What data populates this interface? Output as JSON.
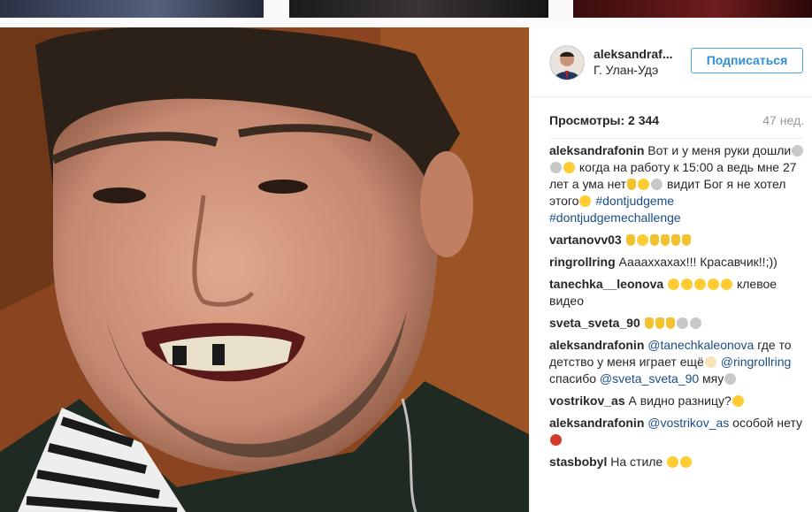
{
  "post": {
    "username": "aleksandraf...",
    "location": "Г. Улан-Удэ",
    "follow_label": "Подписаться",
    "views_label": "Просмотры: 2 344",
    "time": "47 нед."
  },
  "comments": [
    {
      "user": "aleksandrafonin",
      "parts": [
        {
          "t": "text",
          "v": " Вот и у меня руки дошли"
        },
        {
          "t": "emoji",
          "v": "nail-polish-emoji"
        },
        {
          "t": "emoji",
          "v": "nail-polish-emoji"
        },
        {
          "t": "emoji",
          "v": "grin-emoji"
        },
        {
          "t": "text",
          "v": " когда на работу к 15:00 а ведь мне 27 лет а ума нет"
        },
        {
          "t": "emoji",
          "v": "hand-emoji"
        },
        {
          "t": "emoji",
          "v": "grin-emoji"
        },
        {
          "t": "emoji",
          "v": "nail-polish-emoji"
        },
        {
          "t": "text",
          "v": " видит Бог я не хотел этого"
        },
        {
          "t": "emoji",
          "v": "grin-emoji"
        },
        {
          "t": "text",
          "v": " "
        },
        {
          "t": "tag",
          "v": "#dontjudgeme"
        },
        {
          "t": "text",
          "v": " "
        },
        {
          "t": "tag",
          "v": "#dontjudgemechallenge"
        }
      ]
    },
    {
      "user": "vartanovv03",
      "parts": [
        {
          "t": "text",
          "v": " "
        },
        {
          "t": "emoji",
          "v": "hand-emoji"
        },
        {
          "t": "emoji",
          "v": "grin-emoji"
        },
        {
          "t": "emoji",
          "v": "hand-emoji"
        },
        {
          "t": "emoji",
          "v": "hand-emoji"
        },
        {
          "t": "emoji",
          "v": "hand-emoji"
        },
        {
          "t": "emoji",
          "v": "hand-emoji"
        }
      ]
    },
    {
      "user": "ringrollring",
      "parts": [
        {
          "t": "text",
          "v": " Ааааххахах!!! Красавчик!!;))"
        }
      ]
    },
    {
      "user": "tanechka__leonova",
      "parts": [
        {
          "t": "text",
          "v": " "
        },
        {
          "t": "emoji",
          "v": "grin-emoji"
        },
        {
          "t": "emoji",
          "v": "grin-emoji"
        },
        {
          "t": "emoji",
          "v": "grin-emoji"
        },
        {
          "t": "emoji",
          "v": "grin-emoji"
        },
        {
          "t": "emoji",
          "v": "grin-emoji"
        },
        {
          "t": "text",
          "v": " клевое видео"
        }
      ]
    },
    {
      "user": "sveta_sveta_90",
      "parts": [
        {
          "t": "text",
          "v": " "
        },
        {
          "t": "emoji",
          "v": "hand-emoji"
        },
        {
          "t": "emoji",
          "v": "hand-emoji"
        },
        {
          "t": "emoji",
          "v": "hand-emoji"
        },
        {
          "t": "emoji",
          "v": "cat-emoji"
        },
        {
          "t": "emoji",
          "v": "cat-emoji"
        }
      ]
    },
    {
      "user": "aleksandrafonin",
      "parts": [
        {
          "t": "text",
          "v": " "
        },
        {
          "t": "tag",
          "v": "@tanechkaleonova"
        },
        {
          "t": "text",
          "v": " где то детство у меня играет ещё"
        },
        {
          "t": "emoji",
          "v": "monkey-emoji"
        },
        {
          "t": "text",
          "v": " "
        },
        {
          "t": "tag",
          "v": "@ringrollring"
        },
        {
          "t": "text",
          "v": " спасибо "
        },
        {
          "t": "tag",
          "v": "@sveta_sveta_90"
        },
        {
          "t": "text",
          "v": " мяу"
        },
        {
          "t": "emoji",
          "v": "cat-emoji"
        }
      ]
    },
    {
      "user": "vostrikov_as",
      "parts": [
        {
          "t": "text",
          "v": " А видно разницу?"
        },
        {
          "t": "emoji",
          "v": "grin-emoji"
        }
      ]
    },
    {
      "user": "aleksandrafonin",
      "parts": [
        {
          "t": "text",
          "v": " "
        },
        {
          "t": "tag",
          "v": "@vostrikov_as"
        },
        {
          "t": "text",
          "v": " особой нету"
        },
        {
          "t": "emoji",
          "v": "devil-emoji"
        }
      ]
    },
    {
      "user": "stasbobyl",
      "parts": [
        {
          "t": "text",
          "v": " На стиле "
        },
        {
          "t": "emoji",
          "v": "grin-emoji"
        },
        {
          "t": "emoji",
          "v": "grin-emoji"
        }
      ]
    }
  ]
}
